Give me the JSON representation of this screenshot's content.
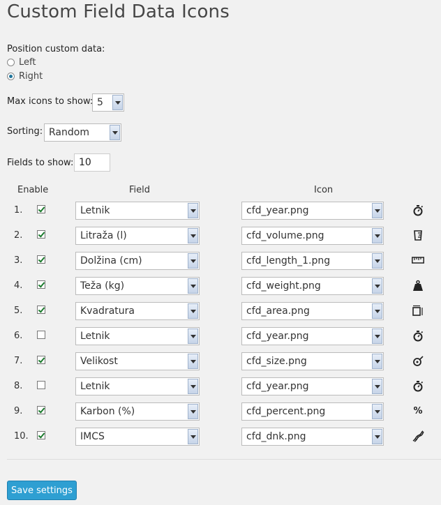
{
  "page": {
    "title": "Custom Field Data Icons"
  },
  "position": {
    "label": "Position custom data:",
    "options": [
      "Left",
      "Right"
    ],
    "selected": "Right"
  },
  "max_icons": {
    "label": "Max icons to show:",
    "value": "5"
  },
  "sorting": {
    "label": "Sorting:",
    "value": "Random"
  },
  "fields_to_show": {
    "label": "Fields to show:",
    "value": "10"
  },
  "table": {
    "headers": {
      "enable": "Enable",
      "field": "Field",
      "icon": "Icon"
    },
    "rows": [
      {
        "num": "1.",
        "enabled": true,
        "field": "Letnik",
        "icon_file": "cfd_year.png",
        "icon": "stopwatch-icon"
      },
      {
        "num": "2.",
        "enabled": true,
        "field": "Litraža (l)",
        "icon_file": "cfd_volume.png",
        "icon": "measuring-cup-icon"
      },
      {
        "num": "3.",
        "enabled": true,
        "field": "Dolžina (cm)",
        "icon_file": "cfd_length_1.png",
        "icon": "ruler-icon"
      },
      {
        "num": "4.",
        "enabled": true,
        "field": "Teža (kg)",
        "icon_file": "cfd_weight.png",
        "icon": "weight-icon"
      },
      {
        "num": "5.",
        "enabled": true,
        "field": "Kvadratura",
        "icon_file": "cfd_area.png",
        "icon": "area-icon"
      },
      {
        "num": "6.",
        "enabled": false,
        "field": "Letnik",
        "icon_file": "cfd_year.png",
        "icon": "stopwatch-icon"
      },
      {
        "num": "7.",
        "enabled": true,
        "field": "Velikost",
        "icon_file": "cfd_size.png",
        "icon": "tape-measure-icon"
      },
      {
        "num": "8.",
        "enabled": false,
        "field": "Letnik",
        "icon_file": "cfd_year.png",
        "icon": "stopwatch-icon"
      },
      {
        "num": "9.",
        "enabled": true,
        "field": "Karbon (%)",
        "icon_file": "cfd_percent.png",
        "icon": "percent-icon"
      },
      {
        "num": "10.",
        "enabled": true,
        "field": "IMCS",
        "icon_file": "cfd_dnk.png",
        "icon": "dna-icon"
      }
    ]
  },
  "save_button": {
    "label": "Save settings"
  },
  "colors": {
    "accent": "#2e9fd2",
    "check": "#1a7a2c",
    "background": "#f1f1f1"
  }
}
